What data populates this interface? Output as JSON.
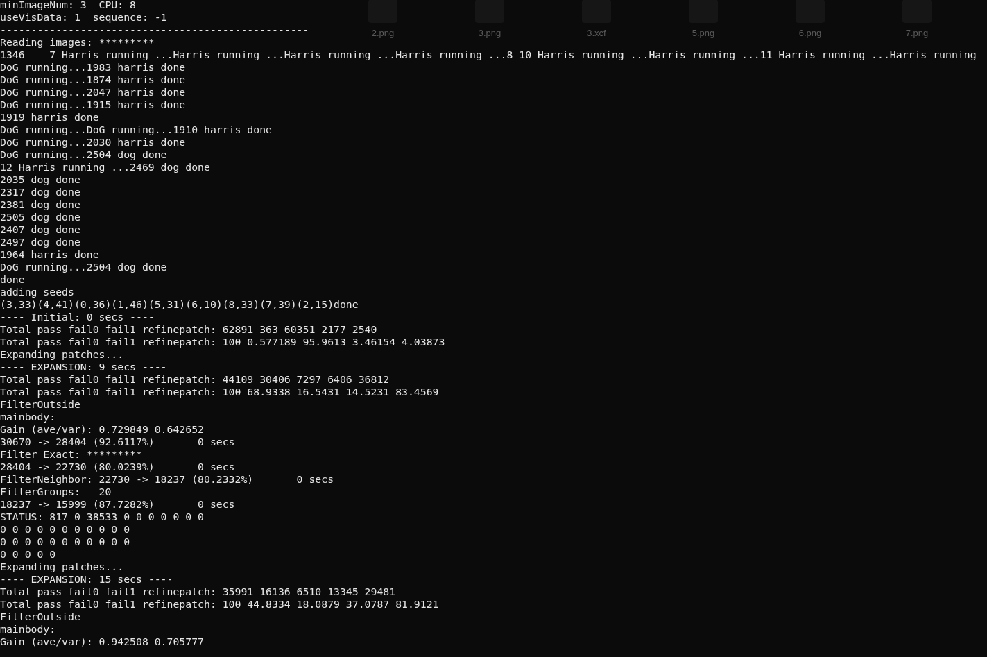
{
  "desktop_files": [
    {
      "label": "2.png"
    },
    {
      "label": "3.png"
    },
    {
      "label": "3.xcf"
    },
    {
      "label": "5.png"
    },
    {
      "label": "6.png"
    },
    {
      "label": "7.png"
    }
  ],
  "terminal": {
    "lines": [
      "minImageNum: 3  CPU: 8",
      "useVisData: 1  sequence: -1",
      "--------------------------------------------------",
      "Reading images: *********",
      "1346    7 Harris running ...Harris running ...Harris running ...Harris running ...8 10 Harris running ...Harris running ...11 Harris running ...Harris running",
      "DoG running...1983 harris done",
      "DoG running...1874 harris done",
      "DoG running...2047 harris done",
      "DoG running...1915 harris done",
      "1919 harris done",
      "DoG running...DoG running...1910 harris done",
      "DoG running...2030 harris done",
      "DoG running...2504 dog done",
      "12 Harris running ...2469 dog done",
      "2035 dog done",
      "2317 dog done",
      "2381 dog done",
      "2505 dog done",
      "2407 dog done",
      "2497 dog done",
      "1964 harris done",
      "DoG running...2504 dog done",
      "done",
      "adding seeds",
      "(3,33)(4,41)(0,36)(1,46)(5,31)(6,10)(8,33)(7,39)(2,15)done",
      "---- Initial: 0 secs ----",
      "Total pass fail0 fail1 refinepatch: 62891 363 60351 2177 2540",
      "Total pass fail0 fail1 refinepatch: 100 0.577189 95.9613 3.46154 4.03873",
      "Expanding patches...",
      "---- EXPANSION: 9 secs ----",
      "Total pass fail0 fail1 refinepatch: 44109 30406 7297 6406 36812",
      "Total pass fail0 fail1 refinepatch: 100 68.9338 16.5431 14.5231 83.4569",
      "FilterOutside",
      "mainbody:",
      "Gain (ave/var): 0.729849 0.642652",
      "30670 -> 28404 (92.6117%)       0 secs",
      "Filter Exact: *********",
      "28404 -> 22730 (80.0239%)       0 secs",
      "FilterNeighbor: 22730 -> 18237 (80.2332%)       0 secs",
      "FilterGroups:   20",
      "18237 -> 15999 (87.7282%)       0 secs",
      "STATUS: 817 0 38533 0 0 0 0 0 0 0",
      "0 0 0 0 0 0 0 0 0 0 0",
      "0 0 0 0 0 0 0 0 0 0 0",
      "0 0 0 0 0",
      "Expanding patches...",
      "---- EXPANSION: 15 secs ----",
      "Total pass fail0 fail1 refinepatch: 35991 16136 6510 13345 29481",
      "Total pass fail0 fail1 refinepatch: 100 44.8334 18.0879 37.0787 81.9121",
      "FilterOutside",
      "mainbody:",
      "Gain (ave/var): 0.942508 0.705777"
    ]
  }
}
